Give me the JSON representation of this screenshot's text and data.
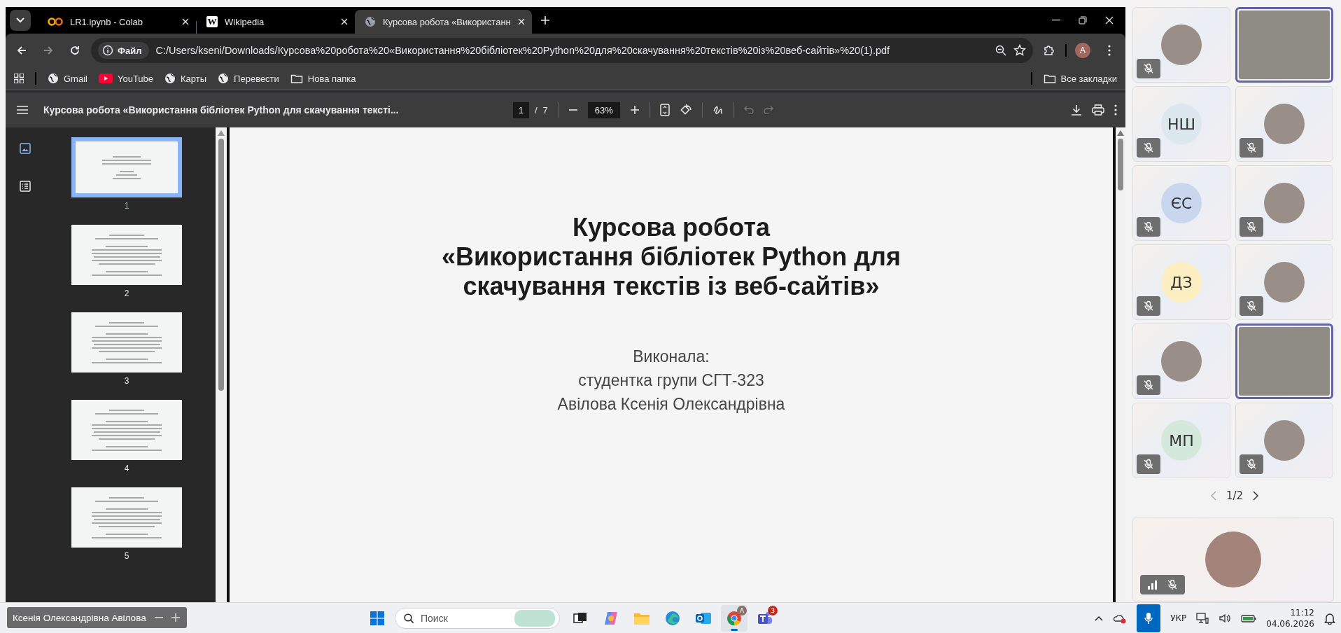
{
  "browser": {
    "tabs": [
      {
        "title": "LR1.ipynb - Colab",
        "kind": "colab",
        "selected": false
      },
      {
        "title": "Wikipedia",
        "kind": "wiki",
        "favicon_text": "W",
        "selected": false
      },
      {
        "title": "Курсова робота «Використанн",
        "kind": "globe",
        "selected": true
      }
    ],
    "address": {
      "site_label": "Файл",
      "url": "C:/Users/kseni/Downloads/Курсова%20робота%20«Використання%20бібліотек%20Python%20для%20скачування%20текстів%20із%20веб-сайтів»%20(1).pdf"
    },
    "profile_initial": "A",
    "bookmarks": [
      {
        "label": "Gmail",
        "kind": "globe"
      },
      {
        "label": "YouTube",
        "kind": "youtube"
      },
      {
        "label": "Карты",
        "kind": "globe"
      },
      {
        "label": "Перевести",
        "kind": "globe"
      },
      {
        "label": "Нова папка",
        "kind": "folder"
      }
    ],
    "all_bookmarks": "Все закладки"
  },
  "pdf": {
    "title": "Курсова робота «Використання бібліотек Python для скачування тексті...",
    "page": "1",
    "page_separator": "/",
    "page_total": "7",
    "zoom": "63%",
    "sidebar_views": [
      {
        "kind": "thumbnails",
        "selected": true
      },
      {
        "kind": "outline",
        "selected": false
      }
    ],
    "thumbnails": [
      {
        "label": "1",
        "selected": true
      },
      {
        "label": "2",
        "selected": false
      },
      {
        "label": "3",
        "selected": false
      },
      {
        "label": "4",
        "selected": false
      },
      {
        "label": "5",
        "selected": false
      }
    ],
    "document": {
      "title_lines": [
        "Курсова робота",
        "«Використання бібліотек Python для",
        "скачування текстів із веб-сайтів»"
      ],
      "author_lines": [
        "Виконала:",
        "студентка групи СГТ-323",
        "Авілова Ксенія Олександрівна"
      ]
    }
  },
  "meeting": {
    "participants": [
      {
        "kind": "photo",
        "muted": true,
        "highlighted": false
      },
      {
        "kind": "video",
        "muted": false,
        "highlighted": true
      },
      {
        "kind": "initials",
        "initials": "НШ",
        "color": "#dde7ee",
        "muted": true,
        "highlighted": false
      },
      {
        "kind": "photo",
        "muted": true,
        "highlighted": false
      },
      {
        "kind": "initials",
        "initials": "ЄС",
        "color": "#c9d7ee",
        "muted": true,
        "highlighted": false
      },
      {
        "kind": "photo",
        "muted": true,
        "highlighted": false
      },
      {
        "kind": "initials",
        "initials": "ДЗ",
        "color": "#fdeec2",
        "muted": true,
        "highlighted": false
      },
      {
        "kind": "photo",
        "muted": true,
        "highlighted": false
      },
      {
        "kind": "photo",
        "muted": true,
        "highlighted": false
      },
      {
        "kind": "video",
        "muted": false,
        "highlighted": true
      },
      {
        "kind": "initials",
        "initials": "МП",
        "color": "#d5e8dc",
        "muted": true,
        "highlighted": false
      },
      {
        "kind": "photo",
        "muted": true,
        "highlighted": false
      }
    ],
    "pager": "1/2",
    "self": {
      "muted": true
    }
  },
  "taskbar": {
    "caption": "Ксенія Олександрівна Авілова",
    "search_placeholder": "Поиск",
    "apps": [
      {
        "kind": "taskview",
        "selected": false
      },
      {
        "kind": "copilot",
        "selected": false
      },
      {
        "kind": "explorer",
        "selected": false
      },
      {
        "kind": "edge",
        "selected": false
      },
      {
        "kind": "outlook",
        "selected": false
      },
      {
        "kind": "chrome",
        "selected": true,
        "badge": "A"
      },
      {
        "kind": "teams",
        "selected": false,
        "badge": "3"
      }
    ],
    "mic_active": true,
    "language": "УКР",
    "time": "11:12",
    "date": "04.06.2026"
  }
}
